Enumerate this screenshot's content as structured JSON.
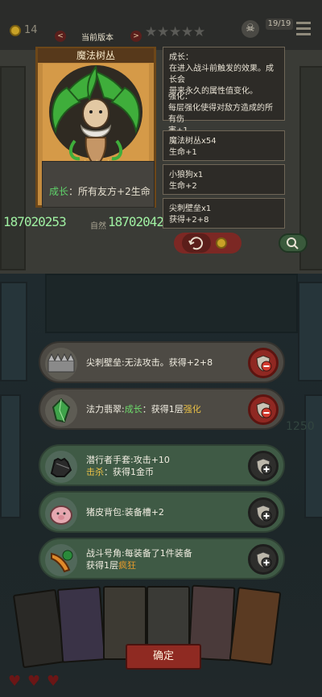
{
  "topbar": {
    "coin_count": "14",
    "version_title": "当前版本",
    "prev_arrow": "<",
    "next_arrow": ">",
    "stars": [
      "★",
      "★",
      "★",
      "★",
      "★"
    ],
    "enemy_count": "19/19"
  },
  "card": {
    "name": "魔法树丛",
    "stars": "★★★",
    "desc_label": "成长",
    "desc_text": "：所有友方+2生命"
  },
  "overlay": {
    "num_left": "187020253",
    "num_right": "18702042",
    "natural": "自然"
  },
  "info_panels": [
    {
      "lines": [
        "成长：",
        "在进入战斗前触发的效果。成长会",
        "带来永久的属性值变化。"
      ]
    },
    {
      "lines": [
        "强化：",
        "每层强化使得对敌方造成的所有伤",
        "害+1。"
      ]
    }
  ],
  "summon_list": [
    {
      "name": "魔法树丛x54",
      "effect": "生命+1"
    },
    {
      "name": "小狼狗x1",
      "effect": "生命+2"
    },
    {
      "name": "尖刺壁垒x1",
      "effect": "获得+2+8"
    }
  ],
  "bg_number": "1250",
  "equipment": [
    {
      "name": "尖刺壁垒",
      "text": ":无法攻击。获得+2+8",
      "line2": "",
      "action": "remove",
      "style": "dark"
    },
    {
      "name": "法力翡翠",
      "text": ":",
      "tag": "成长",
      "tail": "：获得1层",
      "tag2": "强化",
      "line2": "",
      "action": "remove",
      "style": "dark"
    },
    {
      "name": "潜行者手套",
      "text": ":攻击+10",
      "line2_tag": "击杀",
      "line2": "：获得1金币",
      "action": "add",
      "style": "green"
    },
    {
      "name": "猪皮背包",
      "text": ":装备槽+2",
      "line2": "",
      "action": "add",
      "style": "green"
    },
    {
      "name": "战斗号角",
      "text": ":每装备了1件装备",
      "line2_pre": "获得1层",
      "line2_tag": "疯狂",
      "action": "add",
      "style": "green"
    }
  ],
  "confirm_label": "确定",
  "colors": {
    "growth_green": "#5fd36a",
    "reinforce_yellow": "#e9c046",
    "frenzy_orange": "#e79b2c",
    "remove_red": "#8f2822"
  }
}
